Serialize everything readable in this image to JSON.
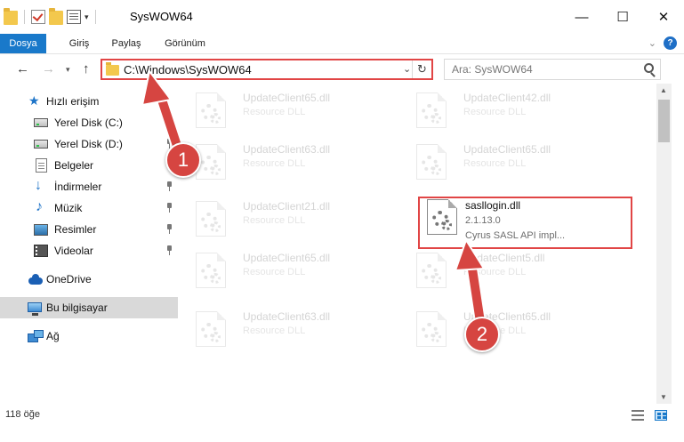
{
  "window": {
    "title": "SysWOW64",
    "minimize": "—",
    "maximize": "☐",
    "close": "✕"
  },
  "ribbon": {
    "tabs": [
      "Dosya",
      "Giriş",
      "Paylaş",
      "Görünüm"
    ],
    "collapse": "⌄",
    "help": "?"
  },
  "navigation": {
    "back": "←",
    "forward": "→",
    "recent": "▾",
    "up": "↑",
    "address": "C:\\Windows\\SysWOW64",
    "dropdown": "⌄",
    "refresh": "↻",
    "search_placeholder": "Ara: SysWOW64"
  },
  "sidebar": {
    "items": [
      {
        "label": "Hızlı erişim",
        "icon": "quick-access-star-icon",
        "pinned": false
      },
      {
        "label": "Yerel Disk (C:)",
        "icon": "local-disk-icon",
        "pinned": false
      },
      {
        "label": "Yerel Disk (D:)",
        "icon": "local-disk-icon",
        "pinned": true
      },
      {
        "label": "Belgeler",
        "icon": "documents-icon",
        "pinned": true
      },
      {
        "label": "İndirmeler",
        "icon": "downloads-icon",
        "pinned": true
      },
      {
        "label": "Müzik",
        "icon": "music-icon",
        "pinned": true
      },
      {
        "label": "Resimler",
        "icon": "pictures-icon",
        "pinned": true
      },
      {
        "label": "Videolar",
        "icon": "videos-icon",
        "pinned": true
      },
      {
        "label": "OneDrive",
        "icon": "onedrive-icon",
        "pinned": false
      },
      {
        "label": "Bu bilgisayar",
        "icon": "this-pc-icon",
        "pinned": false,
        "selected": true
      },
      {
        "label": "Ağ",
        "icon": "network-icon",
        "pinned": false
      }
    ]
  },
  "files": [
    {
      "name": "UpdateClient65.dll",
      "type": "Resource DLL",
      "faded": true
    },
    {
      "name": "UpdateClient42.dll",
      "type": "Resource DLL",
      "faded": true
    },
    {
      "name": "UpdateClient63.dll",
      "type": "Resource DLL",
      "faded": true
    },
    {
      "name": "UpdateClient65.dll",
      "type": "Resource DLL",
      "faded": true
    },
    {
      "name": "UpdateClient21.dll",
      "type": "Resource DLL",
      "faded": true
    },
    {
      "name": "sasllogin.dll",
      "version": "2.1.13.0",
      "type": "Cyrus SASL API impl...",
      "faded": false,
      "highlighted": true
    },
    {
      "name": "UpdateClient65.dll",
      "type": "Resource DLL",
      "faded": true
    },
    {
      "name": "UpdateClient5.dll",
      "type": "Resource DLL",
      "faded": true
    },
    {
      "name": "UpdateClient63.dll",
      "type": "Resource DLL",
      "faded": true
    },
    {
      "name": "UpdateClient65.dll",
      "type": "Resource DLL",
      "faded": true
    }
  ],
  "status": {
    "item_count": "118 öğe"
  },
  "annotations": {
    "step1": "1",
    "step2": "2",
    "color": "#d64541"
  },
  "colors": {
    "accent": "#1979ca",
    "highlight_border": "#e14545"
  }
}
